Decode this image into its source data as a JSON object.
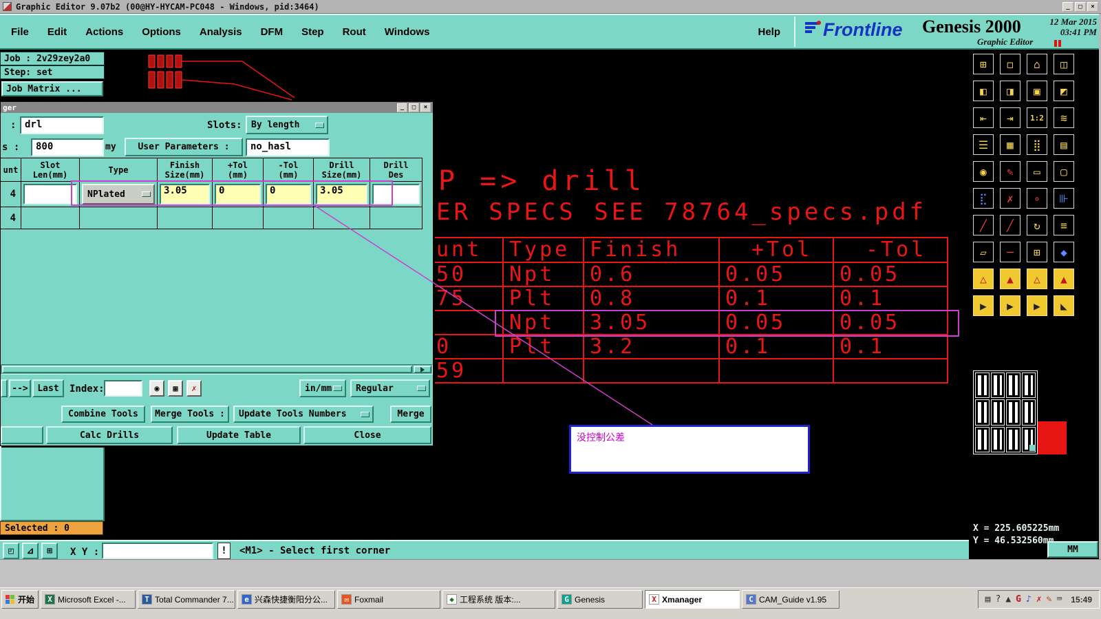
{
  "colors": {
    "teal": "#7dd7c6",
    "canvas_red": "#ea1515",
    "magenta": "#cc3ecc",
    "annotation_text": "#cc00cc",
    "annotation_border": "#2222cc",
    "field_yellow": "#ffffb4",
    "selected_bg": "#eca33f",
    "icon_yellow": "#f5d44a"
  },
  "titlebar": {
    "title": "Graphic Editor 9.07b2 (00@HY-HYCAM-PC048 - Windows, pid:3464)",
    "minimize_glyph": "_",
    "maximize_glyph": "□",
    "close_glyph": "×"
  },
  "menubar": {
    "items": [
      "File",
      "Edit",
      "Actions",
      "Options",
      "Analysis",
      "DFM",
      "Step",
      "Rout",
      "Windows"
    ],
    "help": "Help"
  },
  "brand": {
    "logo": "Frontline",
    "product": "Genesis 2000",
    "edition": "Graphic Editor",
    "date": "12 Mar 2015",
    "time": "03:41 PM"
  },
  "left_panel": {
    "job": "Job : 2v29zey2a0",
    "step": "Step: set",
    "job_matrix": "Job Matrix ...",
    "selected": "Selected : 0"
  },
  "dialog": {
    "title": "ger",
    "name_label": ":",
    "name_value": "drl",
    "slots_label": "Slots:",
    "slots_value": "By length",
    "tol_label": "s :",
    "tol_value": "800",
    "dummy_label": "my",
    "user_params_label": "User Parameters :",
    "user_params_value": "no_hasl",
    "table": {
      "headers": [
        "unt",
        "Slot\nLen(mm)",
        "Type",
        "Finish\nSize(mm)",
        "+Tol\n(mm)",
        "-Tol\n(mm)",
        "Drill\nSize(mm)",
        "Drill\nDes"
      ],
      "rows": [
        {
          "count": "4",
          "slot_len": "",
          "type": "NPlated",
          "finish": "3.05",
          "plus_tol": "0",
          "minus_tol": "0",
          "drill_size": "3.05",
          "drill_des": ""
        },
        {
          "count": "4",
          "slot_len": "",
          "type": "",
          "finish": "",
          "plus_tol": "",
          "minus_tol": "",
          "drill_size": "",
          "drill_des": ""
        }
      ]
    },
    "nav": {
      "prev": "-->",
      "last": "Last",
      "index_label": "Index:",
      "index_value": "",
      "units": "in/mm",
      "mode": "Regular"
    },
    "buttons": {
      "combine": "Combine Tools",
      "merge_tools": "Merge Tools :",
      "update_numbers": "Update Tools Numbers",
      "merge": "Merge",
      "calc_drills": "Calc Drills",
      "update_table": "Update Table",
      "close": "Close"
    }
  },
  "canvas": {
    "headline": "P => drill",
    "specs_line": "ER SPECS SEE 78764_specs.pdf",
    "drill_table": {
      "headers": [
        "unt",
        "Type",
        "Finish",
        "+Tol",
        "-Tol"
      ],
      "rows": [
        [
          "50",
          "Npt",
          "0.6",
          "0.05",
          "0.05"
        ],
        [
          "75",
          "Plt",
          "0.8",
          "0.1",
          "0.1"
        ],
        [
          "",
          "Npt",
          "3.05",
          "0.05",
          "0.05"
        ],
        [
          "0",
          "Plt",
          "3.2",
          "0.1",
          "0.1"
        ],
        [
          "59",
          "",
          "",
          "",
          ""
        ]
      ]
    },
    "annotation": "没控制公差"
  },
  "right_panel": {
    "icons": [
      "⊞",
      "◻",
      "⌂",
      "◫",
      "◧",
      "◨",
      "▣",
      "◩",
      "⇤",
      "⇥",
      "1:2",
      "≋",
      "☰",
      "▦",
      "⣿",
      "▤",
      "◉",
      "✎",
      "▭",
      "▢",
      "⣏",
      "✗",
      "∘",
      "⊪",
      "╱",
      "╱",
      "↻",
      "≡",
      "▱",
      "─",
      "⊞",
      "◆",
      "△",
      "▲",
      "△",
      "▲",
      "▶",
      "▶",
      "▶",
      "◣"
    ],
    "coord_x": "X = 225.605225mm",
    "coord_y": "Y = 46.532560mm"
  },
  "statusbar": {
    "icon1": "◰",
    "icon2": "⊿",
    "icon3": "⊞",
    "xy_label": "X Y :",
    "xy_value": "",
    "alert": "!",
    "prompt": "<M1> - Select first corner",
    "units": "MM"
  },
  "taskbar": {
    "start": "开始",
    "tasks": [
      "Microsoft Excel -...",
      "Total Commander 7...",
      "兴森快捷衡阳分公...",
      "Foxmail",
      "工程系统  版本:...",
      "Genesis",
      "Xmanager",
      "CAM_Guide v1.95"
    ],
    "task_icon_glyphs": [
      "X",
      "T",
      "e",
      "✉",
      "◆",
      "G",
      "X",
      "C"
    ],
    "tray_icons": [
      "▤",
      "?",
      "▲",
      "G",
      "♪",
      "✗",
      "✎",
      "⌨"
    ],
    "tray_time": "15:49"
  }
}
